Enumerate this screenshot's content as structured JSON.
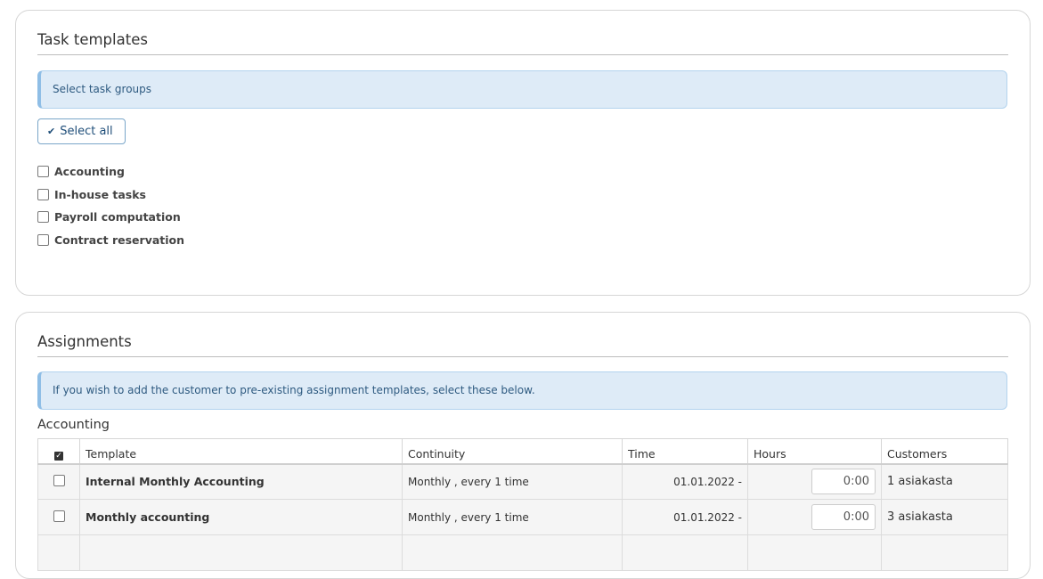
{
  "task_templates": {
    "title": "Task templates",
    "info": "Select task groups",
    "select_all_label": "Select all",
    "groups": [
      {
        "label": "Accounting"
      },
      {
        "label": "In-house tasks"
      },
      {
        "label": "Payroll computation"
      },
      {
        "label": "Contract reservation"
      }
    ]
  },
  "assignments": {
    "title": "Assignments",
    "info": "If you wish to add the customer to pre-existing assignment templates, select these below.",
    "section_label": "Accounting",
    "columns": {
      "template": "Template",
      "continuity": "Continuity",
      "time": "Time",
      "hours": "Hours",
      "customers": "Customers"
    },
    "rows": [
      {
        "template": "Internal Monthly Accounting",
        "continuity": "Monthly , every 1 time",
        "time": "01.01.2022 -",
        "hours": "0:00",
        "customers": "1 asiakasta"
      },
      {
        "template": "Monthly accounting",
        "continuity": "Monthly , every 1 time",
        "time": "01.01.2022 -",
        "hours": "0:00",
        "customers": "3 asiakasta"
      }
    ]
  },
  "colors": {
    "info_bg": "#deebf7",
    "info_text": "#2e5a80",
    "button_border": "#7aa6c9"
  }
}
